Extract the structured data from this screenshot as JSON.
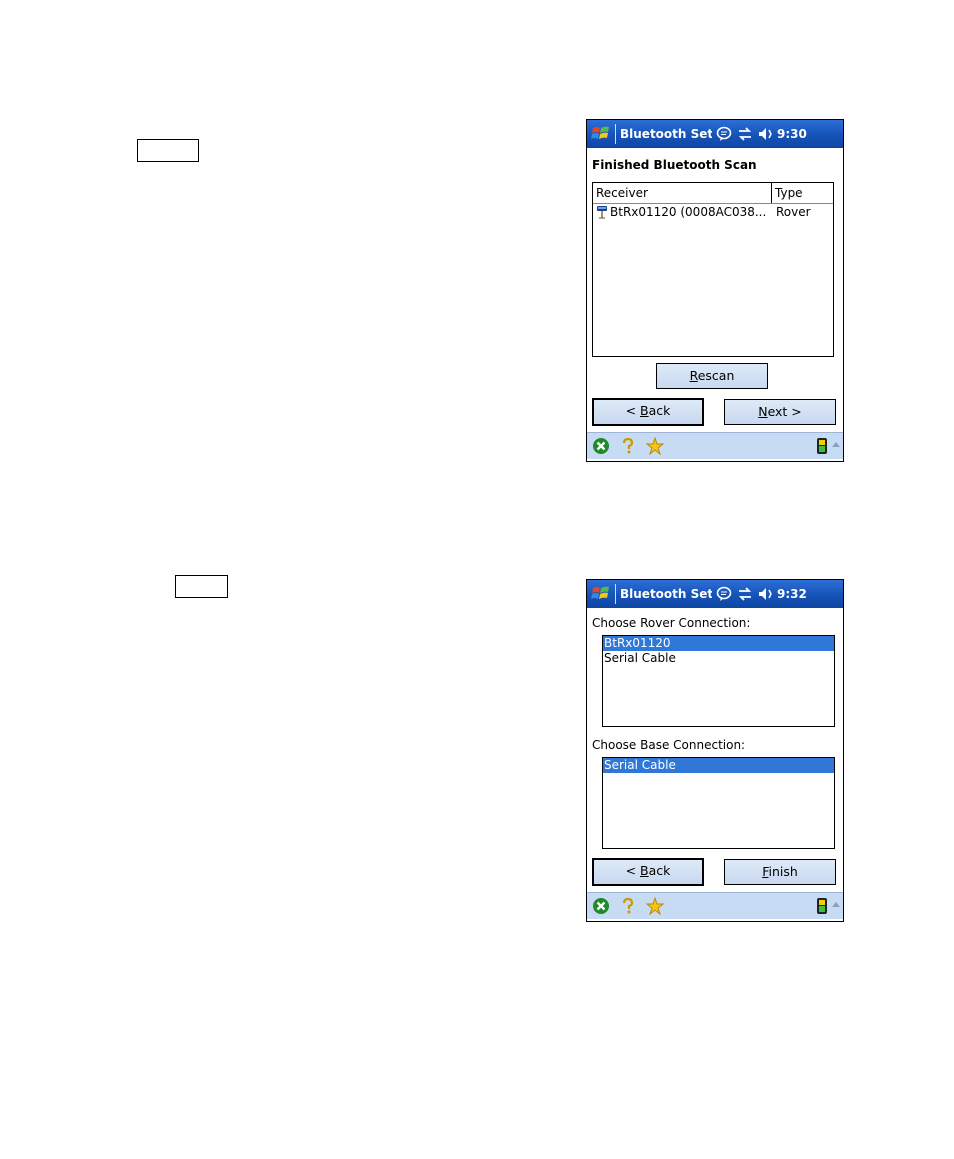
{
  "screen1": {
    "title": "Bluetooth Setu",
    "time": "9:30",
    "heading": "Finished Bluetooth Scan",
    "columns": [
      "Receiver",
      "Type"
    ],
    "rows": [
      {
        "receiver": "BtRx01120 (0008AC038...",
        "type": "Rover"
      }
    ],
    "rescan": {
      "u": "R",
      "rest": "escan"
    },
    "back": {
      "pre": "< ",
      "u": "B",
      "rest": "ack"
    },
    "next": {
      "u": "N",
      "rest": "ext >"
    }
  },
  "screen2": {
    "title": "Bluetooth Setu",
    "time": "9:32",
    "rover_label": "Choose Rover Connection:",
    "rover_items": [
      "BtRx01120",
      "Serial Cable"
    ],
    "base_label": "Choose Base Connection:",
    "base_items": [
      "Serial Cable"
    ],
    "back": {
      "pre": "< ",
      "u": "B",
      "rest": "ack"
    },
    "finish": {
      "u": "F",
      "rest": "inish"
    }
  },
  "colors": {
    "titlebar": "#1653b8",
    "selection": "#2f78d8",
    "button": "#c7d8ef",
    "bottombar": "#c8dbf5"
  },
  "icons": [
    "windows-start-icon",
    "message-icon",
    "connectivity-icon",
    "volume-icon",
    "receiver-icon",
    "close-icon",
    "help-icon",
    "favorites-icon",
    "gps-status-icon"
  ]
}
